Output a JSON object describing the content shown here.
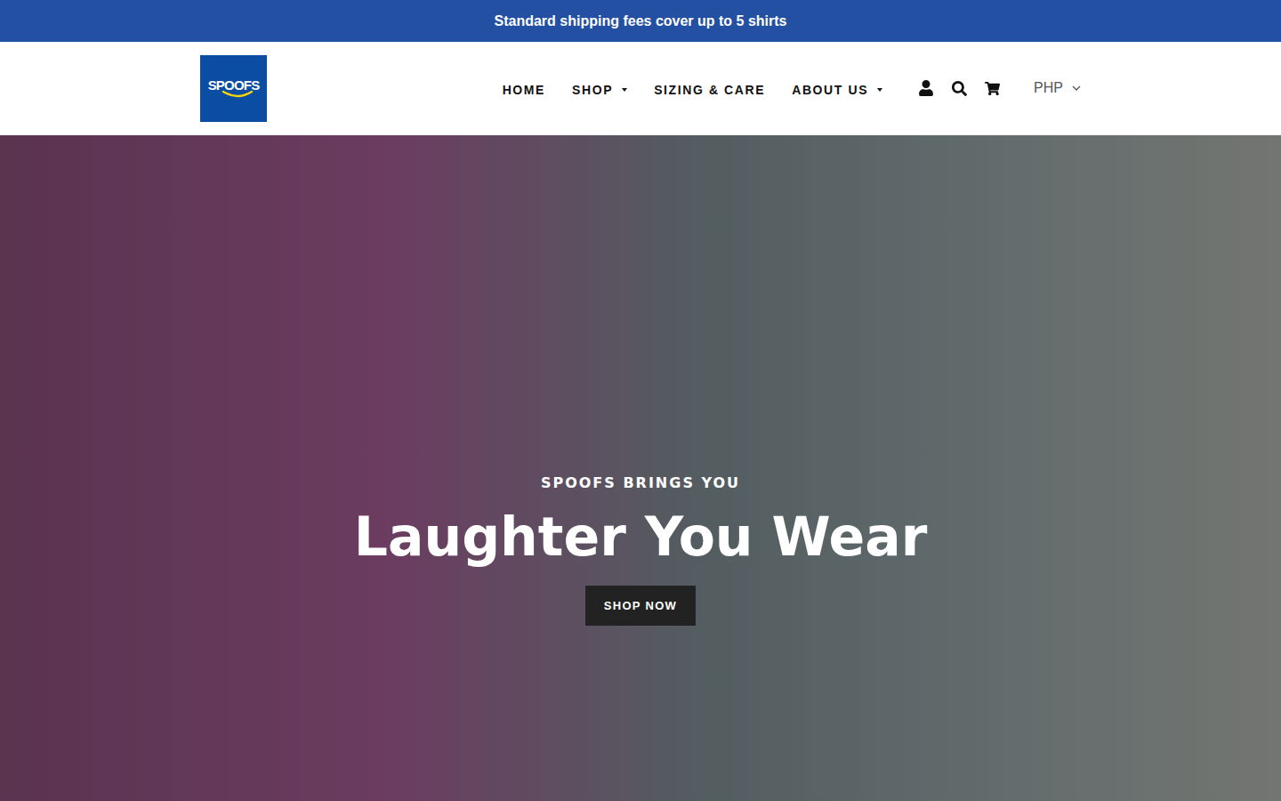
{
  "announcement": "Standard shipping fees cover up to 5 shirts",
  "logo": {
    "text": "SPOOFS"
  },
  "nav": [
    {
      "label": "HOME",
      "dropdown": false
    },
    {
      "label": "SHOP",
      "dropdown": true
    },
    {
      "label": "SIZING & CARE",
      "dropdown": false
    },
    {
      "label": "ABOUT US",
      "dropdown": true
    }
  ],
  "currency": {
    "value": "PHP",
    "expanded": false
  },
  "hero": {
    "subtitle": "SPOOFS BRINGS YOU",
    "title": "Laughter You Wear",
    "button": "SHOP NOW"
  }
}
